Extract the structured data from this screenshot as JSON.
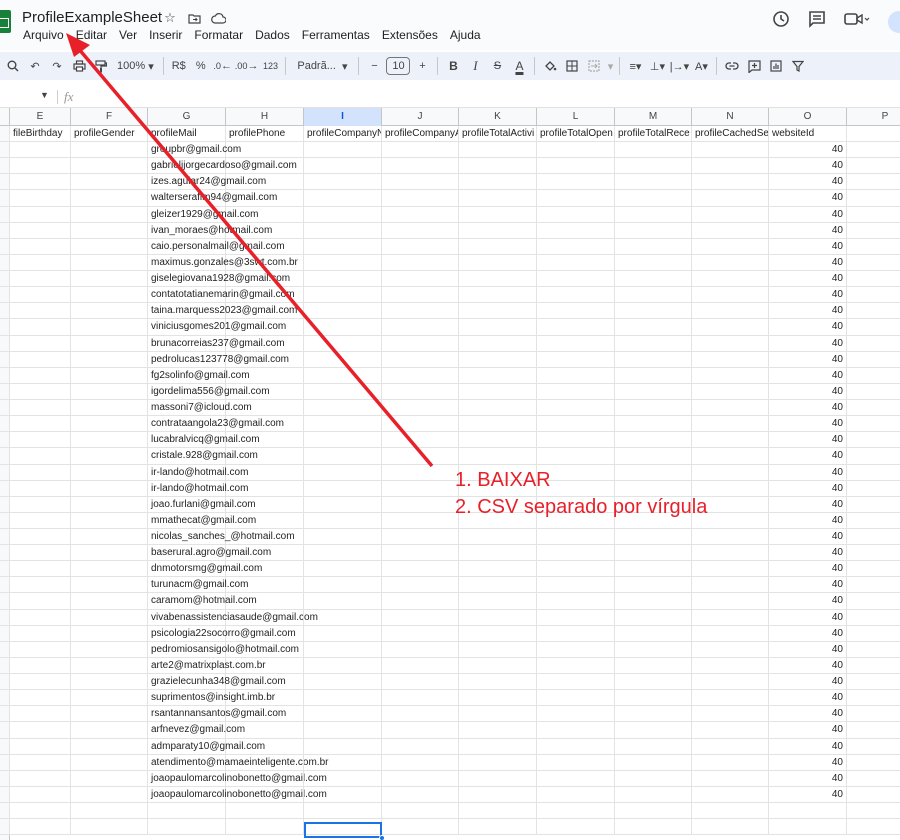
{
  "document": {
    "title": "ProfileExampleSheet"
  },
  "menu": [
    "Arquivo",
    "Editar",
    "Ver",
    "Inserir",
    "Formatar",
    "Dados",
    "Ferramentas",
    "Extensões",
    "Ajuda"
  ],
  "toolbar": {
    "zoom": "100%",
    "currency": "R$",
    "percent": "%",
    "decrease_decimals": ".0←",
    "increase_decimals": ".00",
    "number_format": "123",
    "font": "Padrã...",
    "font_size": "10",
    "bold": "B",
    "italic": "I",
    "text_color": "A"
  },
  "formula_bar": {
    "fx": "fx"
  },
  "columns": [
    {
      "letter": "E",
      "header": "fileBirthday"
    },
    {
      "letter": "F",
      "header": "profileGender"
    },
    {
      "letter": "G",
      "header": "profileMail"
    },
    {
      "letter": "H",
      "header": "profilePhone"
    },
    {
      "letter": "I",
      "header": "profileCompanyN"
    },
    {
      "letter": "J",
      "header": "profileCompanyA"
    },
    {
      "letter": "K",
      "header": "profileTotalActivi"
    },
    {
      "letter": "L",
      "header": "profileTotalOpen"
    },
    {
      "letter": "M",
      "header": "profileTotalRece"
    },
    {
      "letter": "N",
      "header": "profileCachedSe"
    },
    {
      "letter": "O",
      "header": "websiteId"
    },
    {
      "letter": "P",
      "header": ""
    }
  ],
  "selected_column": "I",
  "rows": [
    {
      "mail": "groupbr@gmail.com",
      "website": "40"
    },
    {
      "mail": "gabrieljjorgecardoso@gmail.com",
      "website": "40"
    },
    {
      "mail": "izes.aguiar24@gmail.com",
      "website": "40"
    },
    {
      "mail": "walterserafim94@gmail.com",
      "website": "40"
    },
    {
      "mail": "gleizer1929@gmail.com",
      "website": "40"
    },
    {
      "mail": "ivan_moraes@hotmail.com",
      "website": "40"
    },
    {
      "mail": "caio.personalmail@gmail.com",
      "website": "40"
    },
    {
      "mail": "maximus.gonzales@3swt.com.br",
      "website": "40"
    },
    {
      "mail": "giselegiovana1928@gmail.com",
      "website": "40"
    },
    {
      "mail": "contatotatianemarin@gmail.com",
      "website": "40"
    },
    {
      "mail": "taina.marquess2023@gmail.com",
      "website": "40"
    },
    {
      "mail": "viniciusgomes201@gmail.com",
      "website": "40"
    },
    {
      "mail": "brunacorreias237@gmail.com",
      "website": "40"
    },
    {
      "mail": "pedrolucas123778@gmail.com",
      "website": "40"
    },
    {
      "mail": "fg2solinfo@gmail.com",
      "website": "40"
    },
    {
      "mail": "igordelima556@gmail.com",
      "website": "40"
    },
    {
      "mail": "massoni7@icloud.com",
      "website": "40"
    },
    {
      "mail": "contrataangola23@gmail.com",
      "website": "40"
    },
    {
      "mail": "lucabralvicq@gmail.com",
      "website": "40"
    },
    {
      "mail": "cristale.928@gmail.com",
      "website": "40"
    },
    {
      "mail": "ir-lando@hotmail.com",
      "website": "40"
    },
    {
      "mail": "ir-lando@hotmail.com",
      "website": "40"
    },
    {
      "mail": "joao.furlani@gmail.com",
      "website": "40"
    },
    {
      "mail": "mmathecat@gmail.com",
      "website": "40"
    },
    {
      "mail": "nicolas_sanches_@hotmail.com",
      "website": "40"
    },
    {
      "mail": "baserural.agro@gmail.com",
      "website": "40"
    },
    {
      "mail": "dnmotorsmg@gmail.com",
      "website": "40"
    },
    {
      "mail": "turunacm@gmail.com",
      "website": "40"
    },
    {
      "mail": "caramom@hotmail.com",
      "website": "40"
    },
    {
      "mail": "vivabenassistenciasaude@gmail.com",
      "website": "40"
    },
    {
      "mail": "psicologia22socorro@gmail.com",
      "website": "40"
    },
    {
      "mail": "pedromiosansigolo@hotmail.com",
      "website": "40"
    },
    {
      "mail": "arte2@matrixplast.com.br",
      "website": "40"
    },
    {
      "mail": "grazielecunha348@gmail.com",
      "website": "40"
    },
    {
      "mail": "suprimentos@insight.imb.br",
      "website": "40"
    },
    {
      "mail": "rsantannansantos@gmail.com",
      "website": "40"
    },
    {
      "mail": "arfnevez@gmail.com",
      "website": "40"
    },
    {
      "mail": "admparaty10@gmail.com",
      "website": "40"
    },
    {
      "mail": "atendimento@mamaeinteligente.com.br",
      "website": "40"
    },
    {
      "mail": "joaopaulomarcolinobonetto@gmail.com",
      "website": "40"
    },
    {
      "mail": "joaopaulomarcolinobonetto@gmail.com",
      "website": "40"
    }
  ],
  "annotation": {
    "line1": "1. BAIXAR",
    "line2": "2. CSV separado por vírgula",
    "color": "#e8202a"
  }
}
